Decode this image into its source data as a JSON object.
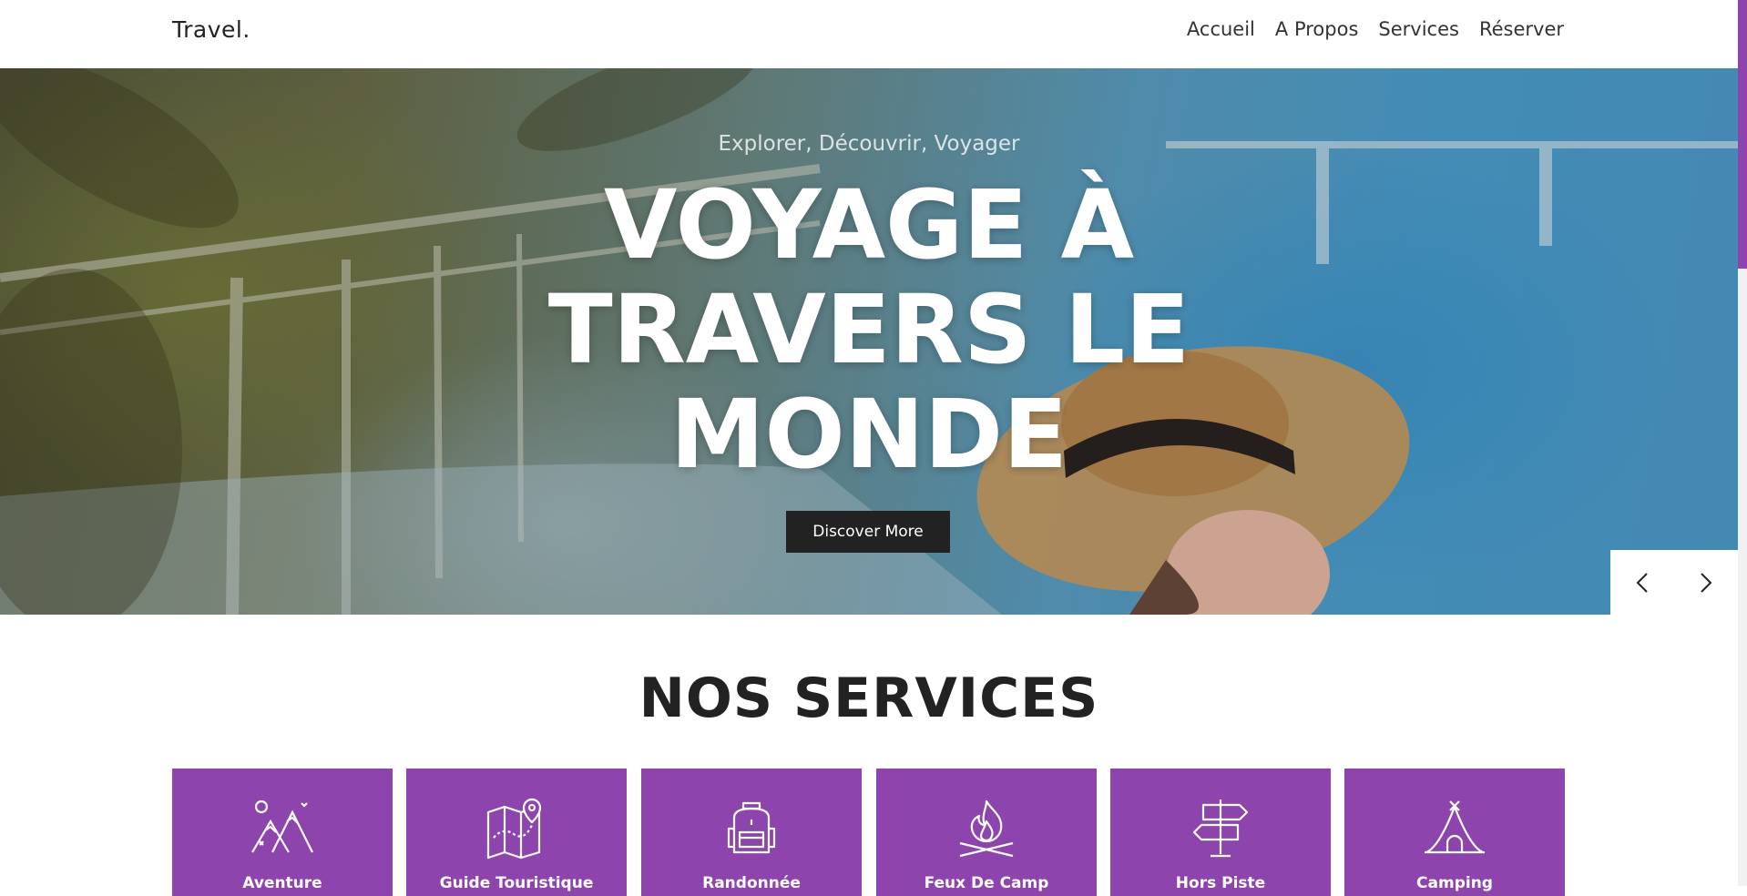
{
  "header": {
    "brand": "Travel.",
    "nav": [
      {
        "label": "Accueil"
      },
      {
        "label": "A Propos"
      },
      {
        "label": "Services"
      },
      {
        "label": "Réserver"
      }
    ]
  },
  "hero": {
    "kicker": "Explorer, Découvrir, Voyager",
    "title_lines": [
      "VOYAGE À",
      "TRAVERS LE",
      "MONDE"
    ],
    "cta_label": "Discover More",
    "prev_icon": "chevron-left-icon",
    "next_icon": "chevron-right-icon"
  },
  "services": {
    "title": "NOS SERVICES",
    "items": [
      {
        "label": "Aventure",
        "icon": "mountains-icon"
      },
      {
        "label": "Guide Touristique",
        "icon": "map-pin-icon"
      },
      {
        "label": "Randonnée",
        "icon": "backpack-icon"
      },
      {
        "label": "Feux De Camp",
        "icon": "campfire-icon"
      },
      {
        "label": "Hors Piste",
        "icon": "signpost-icon"
      },
      {
        "label": "Camping",
        "icon": "tent-icon"
      }
    ]
  },
  "colors": {
    "accent": "#8e44ad",
    "button_dark": "#222222"
  }
}
